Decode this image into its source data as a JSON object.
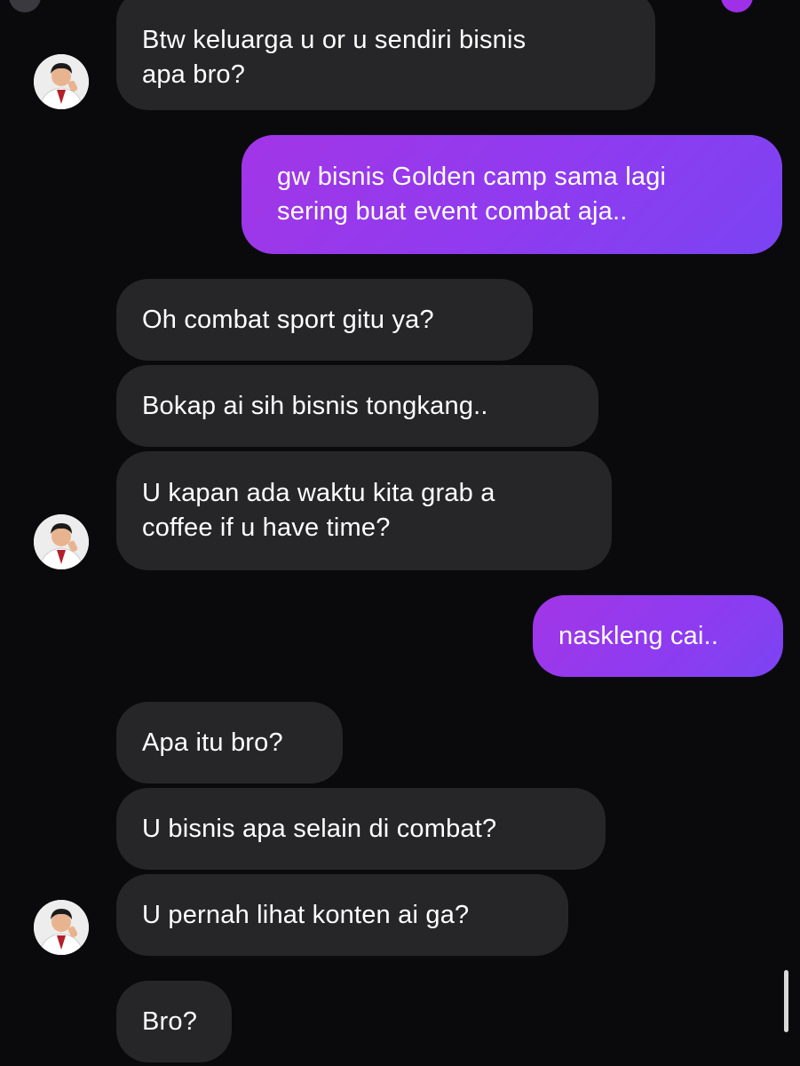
{
  "conversation": {
    "messages": [
      {
        "id": "m1",
        "direction": "received",
        "lines": [
          "Btw keluarga u or u sendiri bisnis",
          "apa bro?"
        ]
      },
      {
        "id": "m2",
        "direction": "sent",
        "lines": [
          "gw bisnis Golden camp sama lagi",
          "sering buat event combat aja.."
        ]
      },
      {
        "id": "m3",
        "direction": "received",
        "lines": [
          "Oh combat sport gitu ya?"
        ]
      },
      {
        "id": "m4",
        "direction": "received",
        "lines": [
          "Bokap ai sih bisnis tongkang.."
        ]
      },
      {
        "id": "m5",
        "direction": "received",
        "lines": [
          "U kapan ada waktu kita grab a",
          "coffee if u have time?"
        ]
      },
      {
        "id": "m6",
        "direction": "sent",
        "lines": [
          "naskleng cai.."
        ]
      },
      {
        "id": "m7",
        "direction": "received",
        "lines": [
          "Apa itu bro?"
        ]
      },
      {
        "id": "m8",
        "direction": "received",
        "lines": [
          "U bisnis apa selain di combat?"
        ]
      },
      {
        "id": "m9",
        "direction": "received",
        "lines": [
          "U pernah lihat konten ai ga?"
        ]
      },
      {
        "id": "m10",
        "direction": "received",
        "lines": [
          "Bro?"
        ]
      }
    ]
  },
  "colors": {
    "background": "#0a0a0d",
    "received_bubble": "#262629",
    "sent_bubble_start": "#a236e6",
    "sent_bubble_end": "#7a44f2",
    "text": "#ffffff"
  },
  "icons": {
    "avatar": "contact-avatar-photo"
  }
}
